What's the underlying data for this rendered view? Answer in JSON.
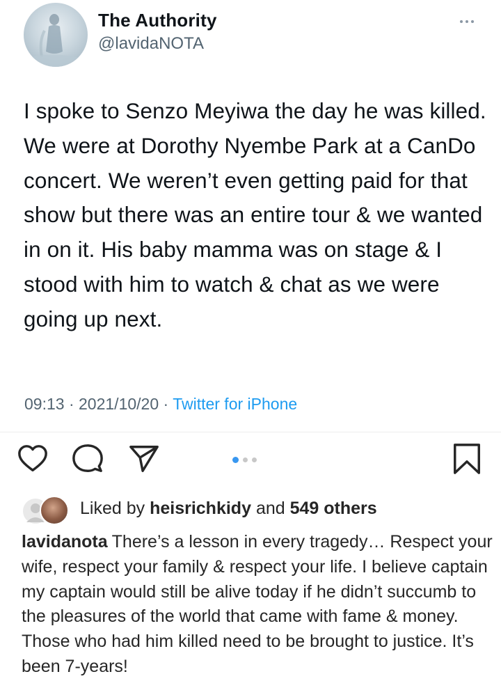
{
  "tweet": {
    "display_name": "The Authority",
    "handle": "@lavidaNOTA",
    "text": "I spoke to Senzo Meyiwa the day he was killed. We were at Dorothy Nyembe Park at a CanDo concert. We weren’t even getting paid for that show but there was an entire tour & we wanted in on it. His baby mamma was on stage & I stood with him to watch & chat as we were going up next.",
    "time": "09:13",
    "date": "2021/10/20",
    "separator": "·",
    "source": "Twitter for iPhone"
  },
  "post": {
    "carousel": {
      "total": 3,
      "active_index": 0
    },
    "likes": {
      "prefix": "Liked by",
      "user": "heisrichkidy",
      "conjunction": "and",
      "others": "549 others"
    },
    "caption": {
      "username": "lavidanota",
      "text": "There’s a lesson in every tragedy… Respect your wife, respect your family & respect your life. I believe captain my captain would still be alive today if he didn’t succumb to the pleasures of the world that came with fame & money. Those who had him killed need to be brought to justice. It’s been 7-years!"
    }
  },
  "icons": {
    "avatar": "profile-photo",
    "more": "more-horizontal-icon",
    "like": "heart-outline-icon",
    "comment": "speech-bubble-icon",
    "share": "paper-plane-icon",
    "save": "bookmark-outline-icon"
  },
  "colors": {
    "text": "#0f1419",
    "secondary": "#536471",
    "link": "#1d9bf0",
    "carousel_active": "#3897f0",
    "carousel_inactive": "#c8c8c8"
  }
}
